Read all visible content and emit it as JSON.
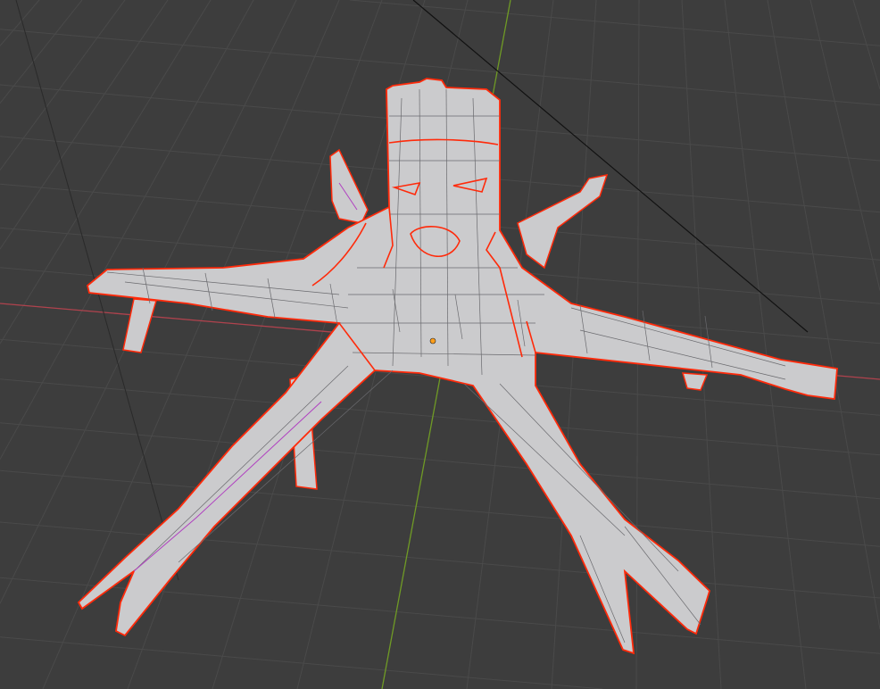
{
  "viewport": {
    "mode": "edit-mode",
    "colors": {
      "background": "#3d3d3d",
      "grid": "#4a4a4a",
      "x_axis": "#b0424d",
      "y_axis": "#6f9a25",
      "mesh_fill": "#cbcbcd",
      "mesh_wire": "#6a6a6e",
      "seam": "#ff2a0a",
      "origin": "#ff9e1a"
    },
    "icons": [
      "object-origin-icon"
    ]
  }
}
